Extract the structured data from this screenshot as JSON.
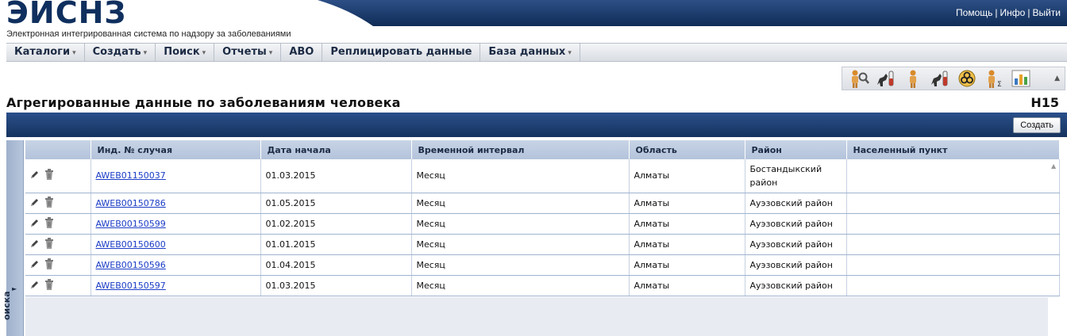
{
  "header": {
    "title": "ЭИСНЗ",
    "subtitle": "Электронная интегрированная система по надзору за заболеваниями",
    "links": [
      "Помощь",
      "Инфо",
      "Выйти"
    ],
    "separator": "|"
  },
  "menu": {
    "items": [
      {
        "label": "Каталоги",
        "has_dropdown": true
      },
      {
        "label": "Создать",
        "has_dropdown": true
      },
      {
        "label": "Поиск",
        "has_dropdown": true
      },
      {
        "label": "Отчеты",
        "has_dropdown": true
      },
      {
        "label": "АВО",
        "has_dropdown": false
      },
      {
        "label": "Реплицировать данные",
        "has_dropdown": false
      },
      {
        "label": "База данных",
        "has_dropdown": true
      }
    ],
    "dropdown_glyph": "▾"
  },
  "toolbar": {
    "icons": [
      "person-search-icon",
      "vet-test-icon",
      "person-icon",
      "animal-test-icon",
      "biohazard-icon",
      "person-sum-icon",
      "bar-chart-report-icon"
    ],
    "collapse_glyph": "▲"
  },
  "page": {
    "title": "Агрегированные данные по заболеваниям человека",
    "form_code": "H15",
    "create_button": "Создать"
  },
  "side_panel": {
    "label": "оиска",
    "arrow": "►"
  },
  "grid": {
    "columns": [
      "",
      "Инд. № случая",
      "Дата начала",
      "Временной интервал",
      "Область",
      "Район",
      "Населенный пункт"
    ],
    "rows": [
      {
        "case_id": "AWEB01150037",
        "start_date": "01.03.2015",
        "interval": "Месяц",
        "region": "Алматы",
        "district": "Бостандыкский район",
        "settlement": ""
      },
      {
        "case_id": "AWEB00150786",
        "start_date": "01.05.2015",
        "interval": "Месяц",
        "region": "Алматы",
        "district": "Ауэзовский район",
        "settlement": ""
      },
      {
        "case_id": "AWEB00150599",
        "start_date": "01.02.2015",
        "interval": "Месяц",
        "region": "Алматы",
        "district": "Ауэзовский район",
        "settlement": ""
      },
      {
        "case_id": "AWEB00150600",
        "start_date": "01.01.2015",
        "interval": "Месяц",
        "region": "Алматы",
        "district": "Ауэзовский район",
        "settlement": ""
      },
      {
        "case_id": "AWEB00150596",
        "start_date": "01.04.2015",
        "interval": "Месяц",
        "region": "Алматы",
        "district": "Ауэзовский район",
        "settlement": ""
      },
      {
        "case_id": "AWEB00150597",
        "start_date": "01.03.2015",
        "interval": "Месяц",
        "region": "Алматы",
        "district": "Ауэзовский район",
        "settlement": ""
      }
    ]
  },
  "colors": {
    "brand_dark_blue": "#16335f",
    "header_title": "#0f2f5e",
    "link": "#1a3cc6"
  }
}
